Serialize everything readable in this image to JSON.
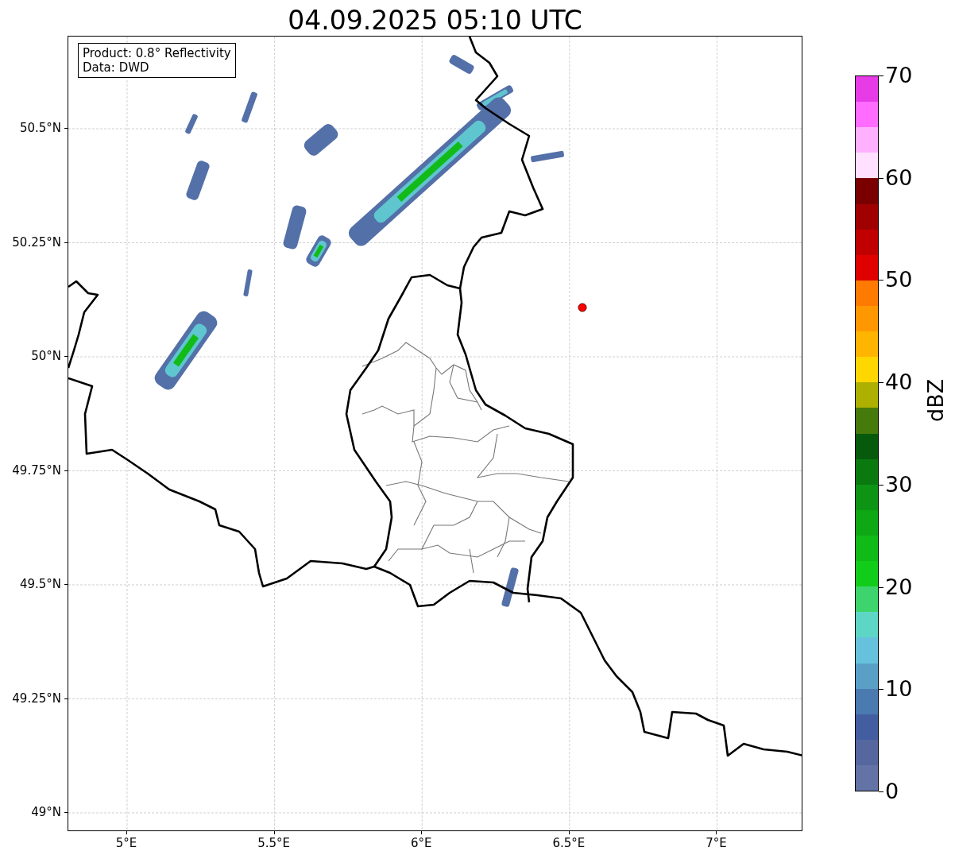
{
  "title": "04.09.2025 05:10 UTC",
  "legend_box": {
    "lines": [
      "Product: 0.8° Reflectivity",
      "Data: DWD"
    ]
  },
  "y_ticks": [
    "50.5°N",
    "50.25°N",
    "50°N",
    "49.75°N",
    "49.5°N",
    "49.25°N",
    "49°N"
  ],
  "x_ticks": [
    "5°E",
    "5.5°E",
    "6°E",
    "6.5°E",
    "7°E"
  ],
  "colorbar": {
    "label": "dBZ",
    "ticks": [
      "70",
      "60",
      "50",
      "40",
      "30",
      "20",
      "10",
      "0"
    ],
    "bins": [
      {
        "color": "#e83be8"
      },
      {
        "color": "#ff6cff"
      },
      {
        "color": "#ffb0ff"
      },
      {
        "color": "#ffe0ff"
      },
      {
        "color": "#7a0000"
      },
      {
        "color": "#a00000"
      },
      {
        "color": "#c00000"
      },
      {
        "color": "#e00000"
      },
      {
        "color": "#ff7a00"
      },
      {
        "color": "#ff9800"
      },
      {
        "color": "#ffb400"
      },
      {
        "color": "#ffd700"
      },
      {
        "color": "#aeb000"
      },
      {
        "color": "#467a0a"
      },
      {
        "color": "#075a0b"
      },
      {
        "color": "#0a7a10"
      },
      {
        "color": "#0d9415"
      },
      {
        "color": "#0ea814"
      },
      {
        "color": "#10bb18"
      },
      {
        "color": "#12cc1a"
      },
      {
        "color": "#3dd46d"
      },
      {
        "color": "#5ed6c6"
      },
      {
        "color": "#66c2dc"
      },
      {
        "color": "#5a9fc6"
      },
      {
        "color": "#4b7ab1"
      },
      {
        "color": "#425ea1"
      },
      {
        "color": "#55679e"
      },
      {
        "color": "#6473a6"
      }
    ]
  }
}
